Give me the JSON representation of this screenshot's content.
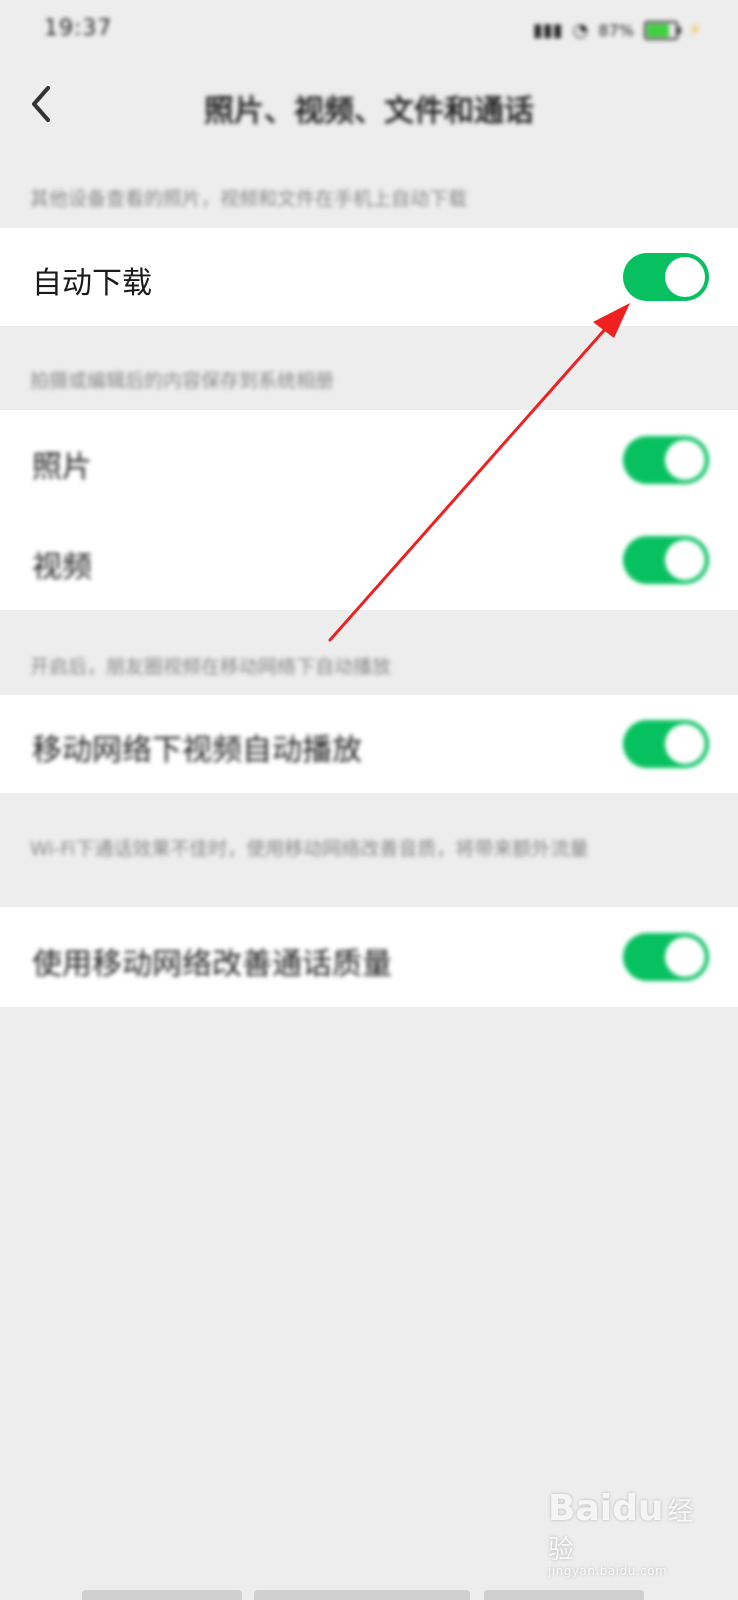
{
  "status_bar": {
    "time": "19:37",
    "battery": "87%"
  },
  "nav": {
    "title": "照片、视频、文件和通话",
    "back_icon": "chevron-left-icon"
  },
  "sections": {
    "auto_download_hint": "其他设备查看的照片，视频和文件在手机上自动下载",
    "auto_download_label": "自动下载",
    "media_hint": "拍摄或编辑后的内容保存到系统相册",
    "photos_label": "照片",
    "videos_label": "视频",
    "autoplay_hint": "开启后，朋友圈视频在移动网络下自动播放",
    "autoplay_label": "移动网络下视频自动播放",
    "call_hint": "Wi-Fi下通话效果不佳时，使用移动网络改善音质，将带来额外流量",
    "call_label": "使用移动网络改善通话质量"
  },
  "toggles": {
    "auto_download": true,
    "photos": true,
    "videos": true,
    "autoplay": true,
    "call_quality": true
  },
  "colors": {
    "toggle_on": "#07c160",
    "arrow": "#f02020",
    "background": "#ededed"
  },
  "watermark": {
    "main": "Baidu",
    "suffix": "经验",
    "url": "jingyan.baidu.com"
  }
}
